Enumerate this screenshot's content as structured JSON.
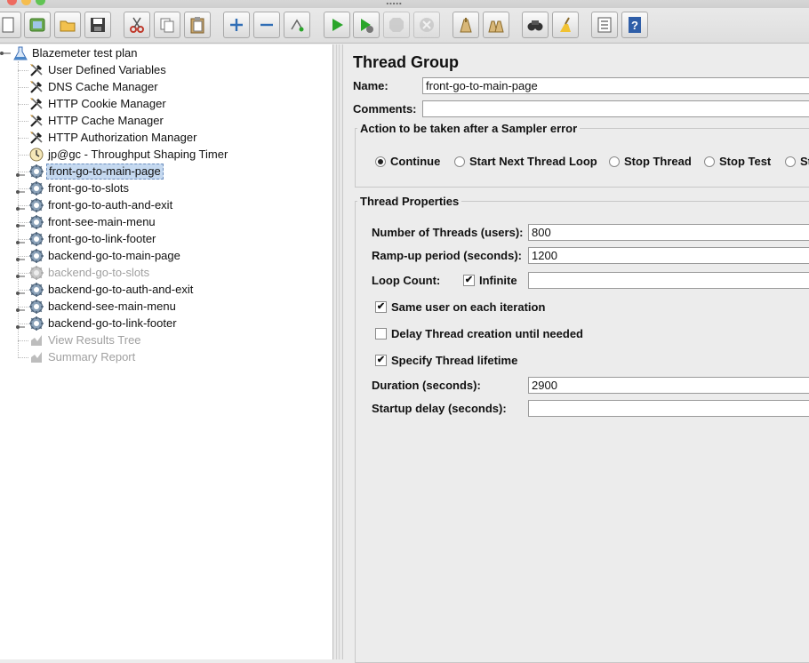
{
  "window": {
    "title": "....."
  },
  "toolbar": {
    "buttons": [
      {
        "icon": "new-icon"
      },
      {
        "icon": "templates-icon"
      },
      {
        "icon": "open-icon"
      },
      {
        "icon": "save-icon"
      },
      {
        "icon": "cut-icon"
      },
      {
        "icon": "copy-icon"
      },
      {
        "icon": "paste-icon"
      },
      {
        "icon": "expand-all-icon"
      },
      {
        "icon": "collapse-all-icon"
      },
      {
        "icon": "toggle-icon"
      },
      {
        "icon": "start-icon"
      },
      {
        "icon": "start-no-pauses-icon"
      },
      {
        "icon": "stop-icon"
      },
      {
        "icon": "shutdown-icon"
      },
      {
        "icon": "clear-icon"
      },
      {
        "icon": "clear-all-icon"
      },
      {
        "icon": "search-icon"
      },
      {
        "icon": "reset-search-icon"
      },
      {
        "icon": "function-helper-icon"
      },
      {
        "icon": "help-icon"
      }
    ]
  },
  "tree": {
    "root": "Blazemeter test plan",
    "items": [
      {
        "label": "User Defined Variables",
        "icon": "config-element-icon",
        "enabled": true
      },
      {
        "label": "DNS Cache Manager",
        "icon": "config-element-icon",
        "enabled": true
      },
      {
        "label": "HTTP Cookie Manager",
        "icon": "config-element-icon",
        "enabled": true
      },
      {
        "label": "HTTP Cache Manager",
        "icon": "config-element-icon",
        "enabled": true
      },
      {
        "label": "HTTP Authorization Manager",
        "icon": "config-element-icon",
        "enabled": true
      },
      {
        "label": "jp@gc - Throughput Shaping Timer",
        "icon": "timer-icon",
        "enabled": true
      },
      {
        "label": "front-go-to-main-page",
        "icon": "thread-group-icon",
        "enabled": true,
        "selected": true
      },
      {
        "label": "front-go-to-slots",
        "icon": "thread-group-icon",
        "enabled": true
      },
      {
        "label": "front-go-to-auth-and-exit",
        "icon": "thread-group-icon",
        "enabled": true
      },
      {
        "label": "front-see-main-menu",
        "icon": "thread-group-icon",
        "enabled": true
      },
      {
        "label": "front-go-to-link-footer",
        "icon": "thread-group-icon",
        "enabled": true
      },
      {
        "label": "backend-go-to-main-page",
        "icon": "thread-group-icon",
        "enabled": true
      },
      {
        "label": "backend-go-to-slots",
        "icon": "thread-group-icon",
        "enabled": false
      },
      {
        "label": "backend-go-to-auth-and-exit",
        "icon": "thread-group-icon",
        "enabled": true
      },
      {
        "label": "backend-see-main-menu",
        "icon": "thread-group-icon",
        "enabled": true
      },
      {
        "label": "backend-go-to-link-footer",
        "icon": "thread-group-icon",
        "enabled": true
      },
      {
        "label": "View Results Tree",
        "icon": "listener-icon",
        "enabled": false
      },
      {
        "label": "Summary Report",
        "icon": "listener-icon",
        "enabled": false
      }
    ]
  },
  "panel": {
    "heading": "Thread Group",
    "name_label": "Name:",
    "name_value": "front-go-to-main-page",
    "comments_label": "Comments:",
    "comments_value": "",
    "sampler_error": {
      "title": "Action to be taken after a Sampler error",
      "options": [
        "Continue",
        "Start Next Thread Loop",
        "Stop Thread",
        "Stop Test",
        "St"
      ],
      "selected": "Continue"
    },
    "thread_props": {
      "title": "Thread Properties",
      "threads_label": "Number of Threads (users):",
      "threads_value": "800",
      "rampup_label": "Ramp-up period (seconds):",
      "rampup_value": "1200",
      "loop_label": "Loop Count:",
      "infinite_label": "Infinite",
      "infinite_checked": true,
      "loop_value": "",
      "same_user_label": "Same user on each iteration",
      "same_user_checked": true,
      "delay_label": "Delay Thread creation until needed",
      "delay_checked": false,
      "lifetime_label": "Specify Thread lifetime",
      "lifetime_checked": true,
      "duration_label": "Duration (seconds):",
      "duration_value": "2900",
      "startup_label": "Startup delay (seconds):",
      "startup_value": ""
    }
  },
  "colors": {
    "selection_bg": "#c5d9f0",
    "play_green": "#2aa52a",
    "panel_bg": "#ececec"
  }
}
